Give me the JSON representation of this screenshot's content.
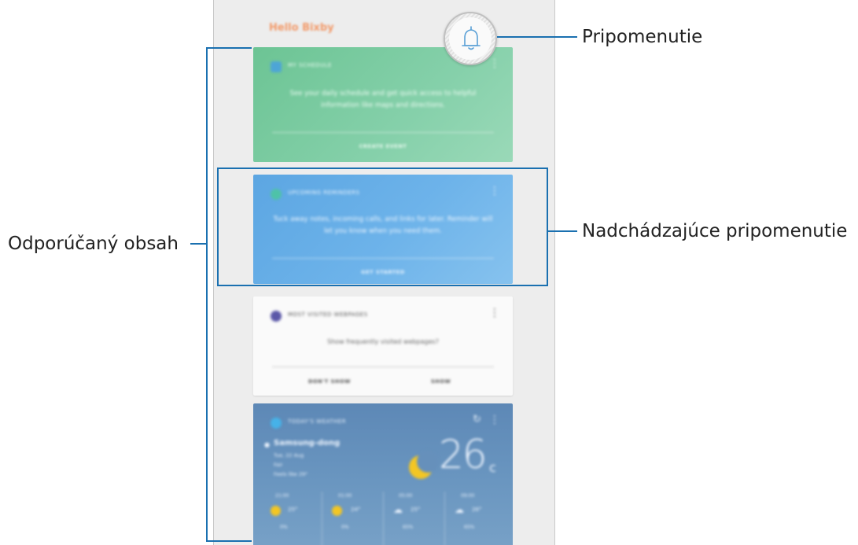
{
  "callouts": {
    "reminder": "Pripomenutie",
    "upcoming_reminders": "Nadchádzajúce pripomenutie",
    "recommended_content": "Odporúčaný obsah"
  },
  "phone": {
    "greeting": "Hello Bixby",
    "cards": {
      "schedule": {
        "title": "MY SCHEDULE",
        "body": "See your daily schedule and get quick access to helpful information like maps and directions.",
        "action": "CREATE EVENT",
        "menu": "⋮"
      },
      "reminders": {
        "title": "UPCOMING REMINDERS",
        "body": "Tuck away notes, incoming calls, and links for later. Reminder will let you know when you need them.",
        "action": "GET STARTED",
        "menu": "⋮"
      },
      "web": {
        "title": "MOST VISITED WEBPAGES",
        "body": "Show frequently visited webpages?",
        "action_left": "DON'T SHOW",
        "action_right": "SHOW",
        "menu": "⋮"
      },
      "weather": {
        "title": "TODAY'S WEATHER",
        "location": "Samsung-dong",
        "date": "Tue, 22 Aug",
        "condition": "Fair",
        "feels_like": "Feels like 29°",
        "temperature": "26",
        "unit": "c",
        "refresh": "↻",
        "menu": "⋮",
        "hourly": [
          {
            "time": "21:00",
            "temp": "25°",
            "rain": "0%"
          },
          {
            "time": "01:00",
            "temp": "24°",
            "rain": "0%"
          },
          {
            "time": "05:00",
            "temp": "25°",
            "rain": "65%"
          },
          {
            "time": "09:00",
            "temp": "26°",
            "rain": "65%"
          }
        ]
      }
    }
  },
  "colors": {
    "callout_line": "#1a70b0",
    "schedule_card": "#6cc494",
    "reminders_card": "#5ca6e2",
    "weather_card": "#5d88b6"
  }
}
